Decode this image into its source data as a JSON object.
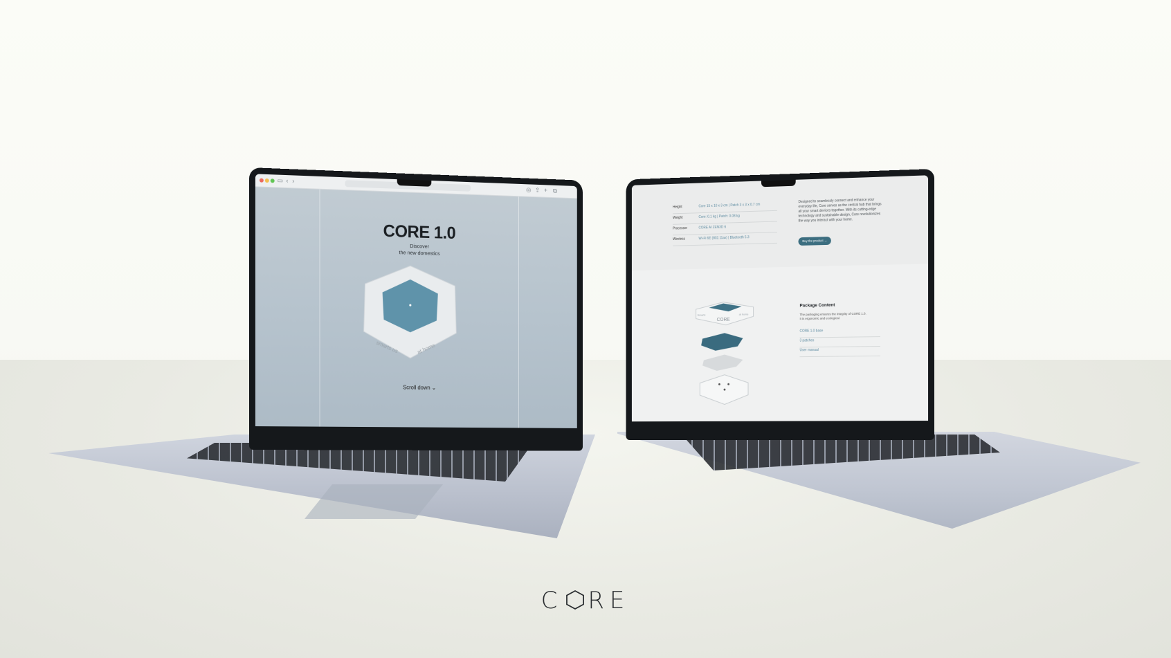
{
  "left_screen": {
    "title": "CORE 1.0",
    "subtitle_line1": "Discover",
    "subtitle_line2": "the new domestics",
    "hex_text_left": "smarts us",
    "hex_text_right": "at home",
    "scroll_label": "Scroll down",
    "browser_icons": [
      "sidebar-icon",
      "back-icon",
      "forward-icon",
      "shield-icon",
      "share-icon",
      "new-tab-icon",
      "tabs-icon"
    ]
  },
  "right_screen": {
    "specs": [
      {
        "label": "Height",
        "value": "Core 15 x 10 x 3 cm | Patch 3 x 3 x 0.7 cm"
      },
      {
        "label": "Weight",
        "value": "Core: 0.1 kg | Patch: 0.08 kg"
      },
      {
        "label": "Processor",
        "value": "CORE AI ZEN3D 6"
      },
      {
        "label": "Wireless",
        "value": "Wi-Fi 6E (802.11ax) | Bluetooth 5.3"
      }
    ],
    "description": "Designed to seamlessly connect and enhance your everyday life, Core serves as the central hub that brings all your smart devices together. With its cutting-edge technology and sustainable design, Core revolutionizes the way you interact with your home.",
    "buy_button": "Buy the product →",
    "package_title": "Package Content",
    "package_desc": "The packaging ensures the integrity of CORE 1.0. It is ergonomic and ecological.",
    "package_items": [
      "CORE 1.0 base",
      "3 patches",
      "User manual"
    ],
    "box_label": "CORE",
    "box_side_left": "Smarts",
    "box_side_right": "at home"
  },
  "brand": {
    "logo_left": "C",
    "logo_right": "RE"
  },
  "colors": {
    "accent": "#3c6e80",
    "hex_blue": "#5f93aa",
    "link": "#5b8aa0"
  }
}
